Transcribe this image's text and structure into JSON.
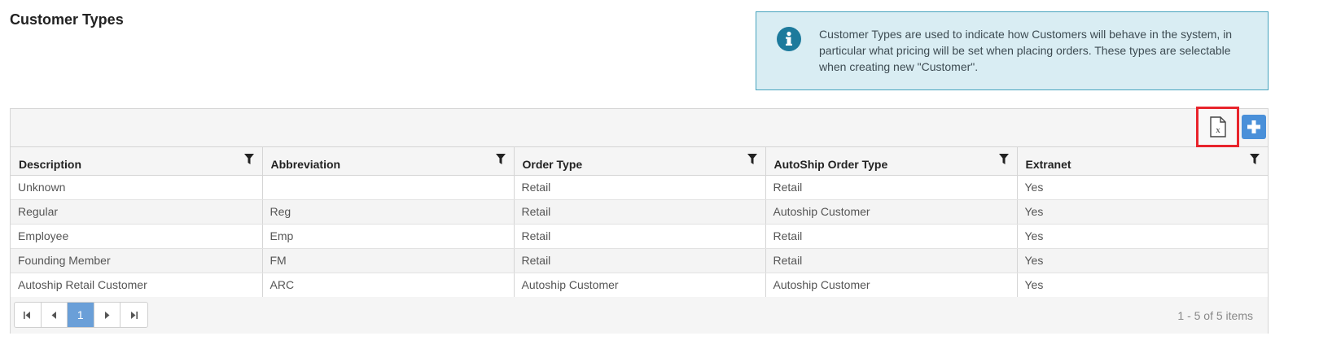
{
  "page": {
    "title": "Customer Types",
    "info_text": "Customer Types are used to indicate how Customers will behave in the system, in particular what pricing will be set when placing orders. These types are selectable when creating new \"Customer\"."
  },
  "toolbar": {
    "excel_icon": "excel-export-icon",
    "add_icon": "plus-icon",
    "accent_color": "#4a90d9",
    "highlight_color": "#e8242c"
  },
  "table": {
    "columns": [
      "Description",
      "Abbreviation",
      "Order Type",
      "AutoShip Order Type",
      "Extranet"
    ],
    "rows": [
      {
        "description": "Unknown",
        "abbreviation": "",
        "order_type": "Retail",
        "autoship_order_type": "Retail",
        "extranet": "Yes"
      },
      {
        "description": "Regular",
        "abbreviation": "Reg",
        "order_type": "Retail",
        "autoship_order_type": "Autoship Customer",
        "extranet": "Yes"
      },
      {
        "description": "Employee",
        "abbreviation": "Emp",
        "order_type": "Retail",
        "autoship_order_type": "Retail",
        "extranet": "Yes"
      },
      {
        "description": "Founding Member",
        "abbreviation": "FM",
        "order_type": "Retail",
        "autoship_order_type": "Retail",
        "extranet": "Yes"
      },
      {
        "description": "Autoship Retail Customer",
        "abbreviation": "ARC",
        "order_type": "Autoship Customer",
        "autoship_order_type": "Autoship Customer",
        "extranet": "Yes"
      }
    ]
  },
  "pager": {
    "current_page": "1",
    "summary": "1 - 5 of 5 items"
  }
}
